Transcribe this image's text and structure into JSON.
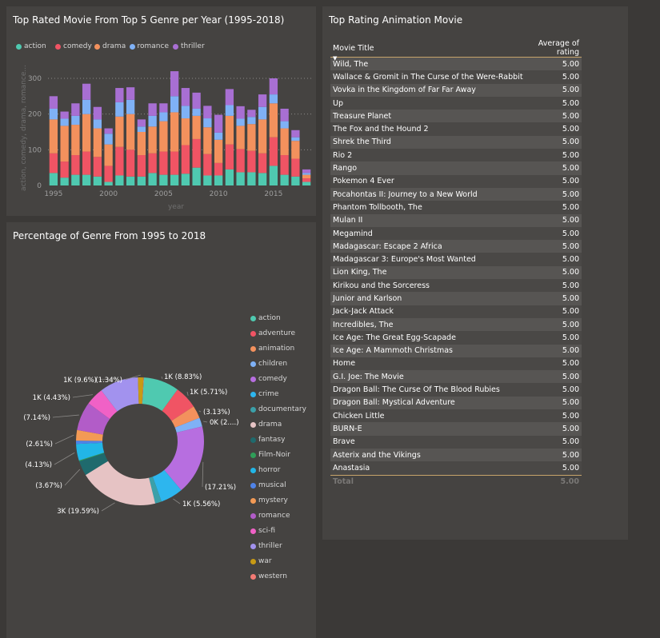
{
  "bar_panel": {
    "title": "Top Rated Movie From Top 5 Genre per Year (1995-2018)",
    "ylabel": "action, comedy, drama, romance...",
    "xlabel": "year"
  },
  "pie_panel": {
    "title": "Percentage of Genre From 1995 to 2018"
  },
  "table_panel": {
    "title": "Top Rating Animation Movie",
    "headers": [
      "Movie Title",
      "Average of rating"
    ],
    "rows": [
      [
        "Wild, The",
        "5.00"
      ],
      [
        "Wallace & Gromit in The Curse of the Were-Rabbit",
        "5.00"
      ],
      [
        "Vovka in the Kingdom of Far Far Away",
        "5.00"
      ],
      [
        "Up",
        "5.00"
      ],
      [
        "Treasure Planet",
        "5.00"
      ],
      [
        "The Fox and the Hound 2",
        "5.00"
      ],
      [
        "Shrek the Third",
        "5.00"
      ],
      [
        "Rio 2",
        "5.00"
      ],
      [
        "Rango",
        "5.00"
      ],
      [
        "Pokemon 4 Ever",
        "5.00"
      ],
      [
        "Pocahontas II: Journey to a New World",
        "5.00"
      ],
      [
        "Phantom Tollbooth, The",
        "5.00"
      ],
      [
        "Mulan II",
        "5.00"
      ],
      [
        "Megamind",
        "5.00"
      ],
      [
        "Madagascar: Escape 2 Africa",
        "5.00"
      ],
      [
        "Madagascar 3: Europe's Most Wanted",
        "5.00"
      ],
      [
        "Lion King, The",
        "5.00"
      ],
      [
        "Kirikou and the Sorceress",
        "5.00"
      ],
      [
        "Junior and Karlson",
        "5.00"
      ],
      [
        "Jack-Jack Attack",
        "5.00"
      ],
      [
        "Incredibles, The",
        "5.00"
      ],
      [
        "Ice Age: The Great Egg-Scapade",
        "5.00"
      ],
      [
        "Ice Age: A Mammoth Christmas",
        "5.00"
      ],
      [
        "Home",
        "5.00"
      ],
      [
        "G.I. Joe: The Movie",
        "5.00"
      ],
      [
        "Dragon Ball: The Curse Of The Blood Rubies",
        "5.00"
      ],
      [
        "Dragon Ball: Mystical Adventure",
        "5.00"
      ],
      [
        "Chicken Little",
        "5.00"
      ],
      [
        "BURN-E",
        "5.00"
      ],
      [
        "Brave",
        "5.00"
      ],
      [
        "Asterix and the Vikings",
        "5.00"
      ],
      [
        "Anastasia",
        "5.00"
      ]
    ],
    "total": [
      "Total",
      "5.00"
    ]
  },
  "chart_data": [
    {
      "type": "bar",
      "stacked": true,
      "title": "Top Rated Movie From Top 5 Genre per Year (1995-2018)",
      "xlabel": "year",
      "ylabel": "action, comedy, drama, romance...",
      "categories": [
        1995,
        1996,
        1997,
        1998,
        1999,
        2000,
        2001,
        2002,
        2003,
        2004,
        2005,
        2006,
        2007,
        2008,
        2009,
        2010,
        2011,
        2012,
        2013,
        2014,
        2015,
        2016,
        2017,
        2018
      ],
      "x_ticks": [
        "1995",
        "2000",
        "2005",
        "2010",
        "2015"
      ],
      "y_ticks": [
        "0",
        "100",
        "200",
        "300"
      ],
      "ylim": [
        0,
        320
      ],
      "grid": true,
      "legend_position": "top-left",
      "series": [
        {
          "name": "action",
          "color": "#4fc9b0",
          "values": [
            35,
            22,
            30,
            30,
            25,
            10,
            28,
            25,
            25,
            35,
            30,
            30,
            33,
            50,
            28,
            28,
            45,
            37,
            37,
            35,
            55,
            30,
            25,
            10
          ]
        },
        {
          "name": "comedy",
          "color": "#f05464",
          "values": [
            55,
            45,
            55,
            65,
            55,
            45,
            80,
            75,
            60,
            55,
            65,
            65,
            80,
            80,
            60,
            35,
            70,
            65,
            60,
            55,
            80,
            55,
            50,
            10
          ]
        },
        {
          "name": "drama",
          "color": "#f3915d",
          "values": [
            95,
            100,
            85,
            105,
            80,
            60,
            85,
            100,
            65,
            75,
            85,
            110,
            75,
            65,
            75,
            65,
            80,
            65,
            75,
            95,
            95,
            75,
            50,
            10
          ]
        },
        {
          "name": "romance",
          "color": "#7fb1f6",
          "values": [
            30,
            20,
            25,
            40,
            25,
            30,
            40,
            40,
            15,
            30,
            25,
            45,
            35,
            20,
            25,
            20,
            30,
            20,
            20,
            35,
            25,
            20,
            10,
            5
          ]
        },
        {
          "name": "thriller",
          "color": "#a86fd3",
          "values": [
            35,
            20,
            35,
            45,
            35,
            15,
            40,
            35,
            20,
            35,
            25,
            70,
            50,
            45,
            35,
            50,
            45,
            35,
            20,
            35,
            45,
            35,
            20,
            10
          ]
        }
      ]
    },
    {
      "type": "pie",
      "donut": true,
      "title": "Percentage of Genre From 1995 to 2018",
      "legend_position": "right",
      "series": [
        {
          "name": "action",
          "color": "#4fc9b0",
          "value": 8.83,
          "label": "1K (8.83%)"
        },
        {
          "name": "adventure",
          "color": "#f05464",
          "value": 5.71,
          "label": "1K (5.71%)"
        },
        {
          "name": "animation",
          "color": "#f3915d",
          "value": 3.13,
          "label": "(3.13%)"
        },
        {
          "name": "children",
          "color": "#7fb1f6",
          "value": 2.2,
          "label": "0K (2....)"
        },
        {
          "name": "comedy",
          "color": "#b76ee0",
          "value": 17.21,
          "label": "(17.21%)"
        },
        {
          "name": "crime",
          "color": "#2db6ee",
          "value": 5.56,
          "label": "1K (5.56%)"
        },
        {
          "name": "documentary",
          "color": "#3ba0a9",
          "value": 1.6,
          "label": ""
        },
        {
          "name": "drama",
          "color": "#e6c3c4",
          "value": 19.59,
          "label": "3K (19.59%)"
        },
        {
          "name": "fantasy",
          "color": "#1f6a6d",
          "value": 3.67,
          "label": "(3.67%)"
        },
        {
          "name": "Film-Noir",
          "color": "#2f9e58",
          "value": 0.2,
          "label": ""
        },
        {
          "name": "horror",
          "color": "#22b6e7",
          "value": 4.13,
          "label": "(4.13%)"
        },
        {
          "name": "musical",
          "color": "#4f83e8",
          "value": 0.8,
          "label": ""
        },
        {
          "name": "mystery",
          "color": "#f39a55",
          "value": 2.61,
          "label": "(2.61%)"
        },
        {
          "name": "romance",
          "color": "#b25cc8",
          "value": 7.14,
          "label": "(7.14%)"
        },
        {
          "name": "sci-fi",
          "color": "#f061c6",
          "value": 4.43,
          "label": "1K (4.43%)"
        },
        {
          "name": "thriller",
          "color": "#a292ee",
          "value": 9.6,
          "label": "1K (9.6%)"
        },
        {
          "name": "war",
          "color": "#c89a14",
          "value": 1.34,
          "label": "(1.34%)"
        },
        {
          "name": "western",
          "color": "#f47a74",
          "value": 0.1,
          "label": ""
        }
      ]
    }
  ]
}
